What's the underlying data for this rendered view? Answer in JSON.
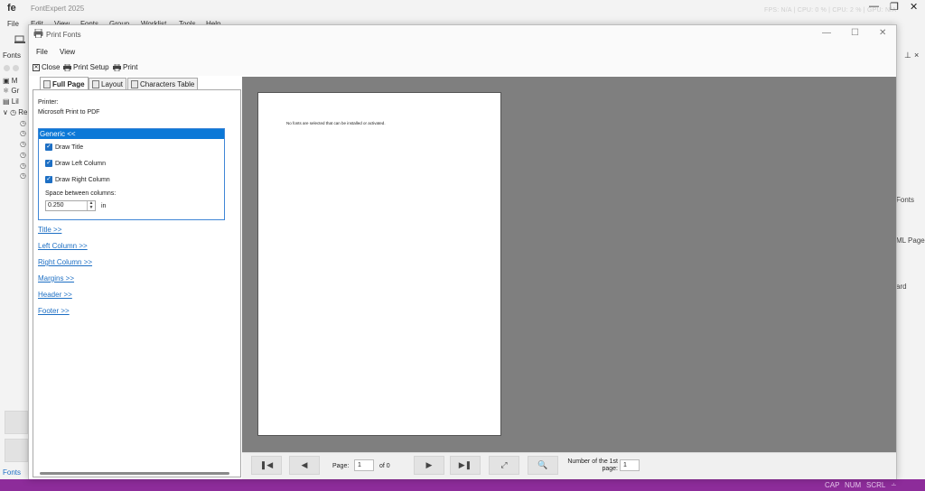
{
  "app": {
    "logo": "fe",
    "title": "FontExpert 2025",
    "status_dim": "FPS: N/A  |  CPU: 0 %  |  CPU: 2 %  |  GPU: N/A",
    "menu": [
      "File",
      "Edit",
      "View",
      "Fonts",
      "Group",
      "Worklist",
      "Tools",
      "Help"
    ],
    "fonts_panel_label": "Fonts",
    "tree_items": [
      "M",
      "Gr",
      "Lil",
      "Re"
    ],
    "fonts_tab": "Fonts",
    "right_labels": [
      "Fonts",
      "ML Page",
      "ard"
    ],
    "pin_icons": [
      "⊥",
      "×"
    ]
  },
  "status_bar": {
    "cap": "CAP",
    "num": "NUM",
    "scrl": "SCRL"
  },
  "dialog": {
    "title": "Print Fonts",
    "menu": [
      "File",
      "View"
    ],
    "toolbar": {
      "close": "Close",
      "print_setup": "Print Setup",
      "print": "Print"
    },
    "tabs": [
      "Full Page",
      "Layout",
      "Characters Table"
    ],
    "printer_label": "Printer:",
    "printer_name": "Microsoft Print to PDF",
    "group_title": "Generic <<",
    "checks": [
      {
        "label": "Draw Title",
        "checked": true
      },
      {
        "label": "Draw Left Column",
        "checked": true
      },
      {
        "label": "Draw Right Column",
        "checked": true
      }
    ],
    "space_label": "Space between columns:",
    "space_value": "0.250",
    "space_unit": "in",
    "links": [
      "Title >>",
      "Left Column >>",
      "Right Column >>",
      "Margins >>",
      "Header >>",
      "Footer >>"
    ],
    "preview_message": "No fonts are selected that can be installed or activated.",
    "nav": {
      "page_label": "Page:",
      "page_value": "1",
      "of_label": "of 0",
      "first_page_label": "Number of the 1st page:",
      "first_page_value": "1"
    }
  },
  "colors": {
    "accent": "#0b78d7",
    "status_bar": "#8d2c9a",
    "preview_bg": "#7f7f7f"
  }
}
